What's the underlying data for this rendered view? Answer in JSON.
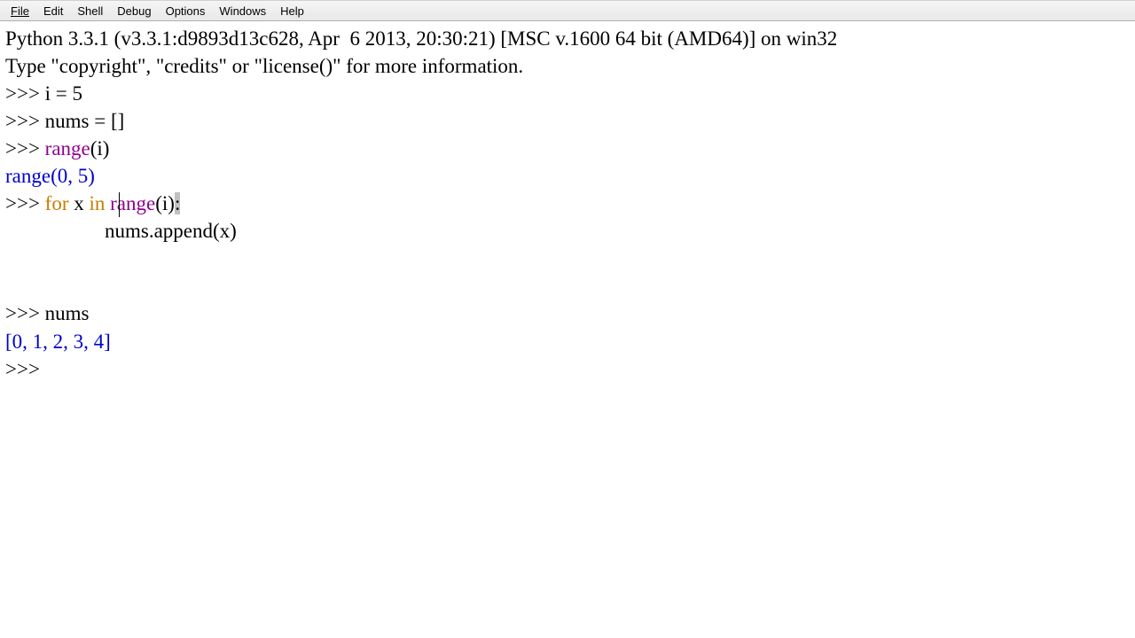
{
  "menubar": {
    "items": [
      "File",
      "Edit",
      "Shell",
      "Debug",
      "Options",
      "Windows",
      "Help"
    ]
  },
  "shell": {
    "banner_line1": "Python 3.3.1 (v3.3.1:d9893d13c628, Apr  6 2013, 20:30:21) [MSC v.1600 64 bit (AMD64)] on win32",
    "banner_line2": "Type \"copyright\", \"credits\" or \"license()\" for more information.",
    "prompt": ">>> ",
    "lines": [
      {
        "prompt": ">>> ",
        "code": "i = 5"
      },
      {
        "prompt": ">>> ",
        "code": "nums = []"
      },
      {
        "prompt": ">>> ",
        "builtin": "range",
        "rest": "(i)"
      },
      {
        "output": "range(0, 5)"
      },
      {
        "prompt": ">>> ",
        "kw1": "for",
        "mid1": " x ",
        "kw2": "in",
        "mid2": " ",
        "builtin": "range",
        "rest": "(i)",
        "colon": ":"
      },
      {
        "indent": true,
        "code": "nums.append(x)"
      },
      {
        "blank": true
      },
      {
        "blank": true
      },
      {
        "prompt": ">>> ",
        "code": "nums"
      },
      {
        "output": "[0, 1, 2, 3, 4]"
      },
      {
        "prompt": ">>> ",
        "code": ""
      }
    ]
  }
}
